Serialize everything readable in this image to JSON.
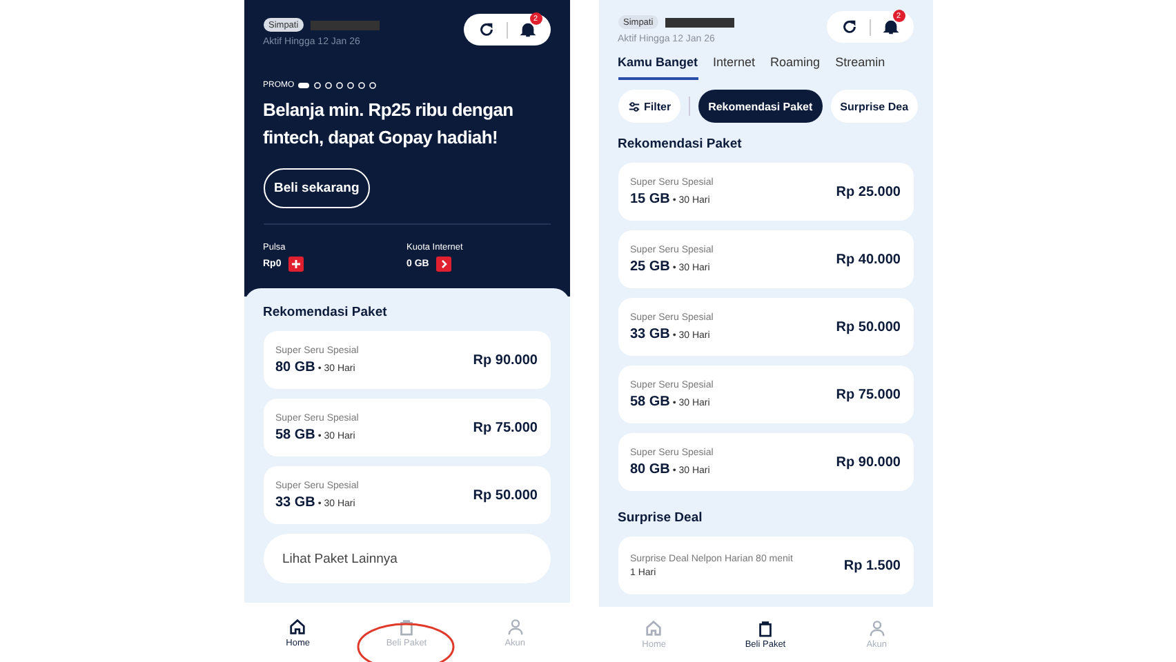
{
  "home_screen": {
    "header": {
      "badge": "Simpati",
      "expiry": "Aktif Hingga 12 Jan 26",
      "notification_count": "2"
    },
    "promo": {
      "label": "PROMO",
      "headline": "Belanja min. Rp25 ribu dengan fintech, dapat Gopay hadiah!",
      "button": "Beli sekarang"
    },
    "balances": [
      {
        "label": "Pulsa",
        "value": "Rp0",
        "kind": "topup"
      },
      {
        "label": "Kuota Internet",
        "value": "0 GB",
        "kind": "more"
      }
    ],
    "section_title": "Rekomendasi Paket",
    "packages": [
      {
        "name": "Super Seru Spesial",
        "quota": "80 GB",
        "duration": "• 30 Hari",
        "price": "Rp 90.000"
      },
      {
        "name": "Super Seru Spesial",
        "quota": "58 GB",
        "duration": "• 30 Hari",
        "price": "Rp 75.000"
      },
      {
        "name": "Super Seru Spesial",
        "quota": "33 GB",
        "duration": "• 30 Hari",
        "price": "Rp 50.000"
      }
    ],
    "more_link": "Lihat Paket Lainnya",
    "nav": [
      {
        "label": "Home",
        "kind": "home",
        "selected": true,
        "circled": false
      },
      {
        "label": "Beli Paket",
        "kind": "bag",
        "selected": false,
        "circled": true
      },
      {
        "label": "Akun",
        "kind": "person",
        "selected": false,
        "circled": false
      }
    ]
  },
  "beli_paket_screen": {
    "header": {
      "badge": "Simpati",
      "expiry": "Aktif Hingga 12 Jan 26",
      "notification_count": "2"
    },
    "tabs": [
      {
        "label": "Kamu Banget",
        "selected": true
      },
      {
        "label": "Internet",
        "selected": false
      },
      {
        "label": "Roaming",
        "selected": false
      },
      {
        "label": "Streamin",
        "selected": false
      }
    ],
    "filter_button": "Filter",
    "chips": [
      {
        "label": "Rekomendasi Paket",
        "selected": true
      },
      {
        "label": "Surprise Dea",
        "selected": false
      }
    ],
    "sections": [
      {
        "title": "Rekomendasi Paket",
        "packages": [
          {
            "name": "Super Seru Spesial",
            "quota": "15 GB",
            "duration": "• 30 Hari",
            "price": "Rp 25.000"
          },
          {
            "name": "Super Seru Spesial",
            "quota": "25 GB",
            "duration": "• 30 Hari",
            "price": "Rp 40.000"
          },
          {
            "name": "Super Seru Spesial",
            "quota": "33 GB",
            "duration": "• 30 Hari",
            "price": "Rp 50.000"
          },
          {
            "name": "Super Seru Spesial",
            "quota": "58 GB",
            "duration": "• 30 Hari",
            "price": "Rp 75.000"
          },
          {
            "name": "Super Seru Spesial",
            "quota": "80 GB",
            "duration": "• 30 Hari",
            "price": "Rp 90.000"
          }
        ]
      },
      {
        "title": "Surprise Deal",
        "packages": [
          {
            "name": "Surprise Deal Nelpon Harian 80 menit",
            "duration": "1 Hari",
            "price": "Rp 1.500"
          }
        ]
      }
    ],
    "nav": [
      {
        "label": "Home",
        "kind": "home",
        "selected": false,
        "circled": false
      },
      {
        "label": "Beli Paket",
        "kind": "bag",
        "selected": true,
        "circled": false
      },
      {
        "label": "Akun",
        "kind": "person",
        "selected": false,
        "circled": false
      }
    ]
  }
}
